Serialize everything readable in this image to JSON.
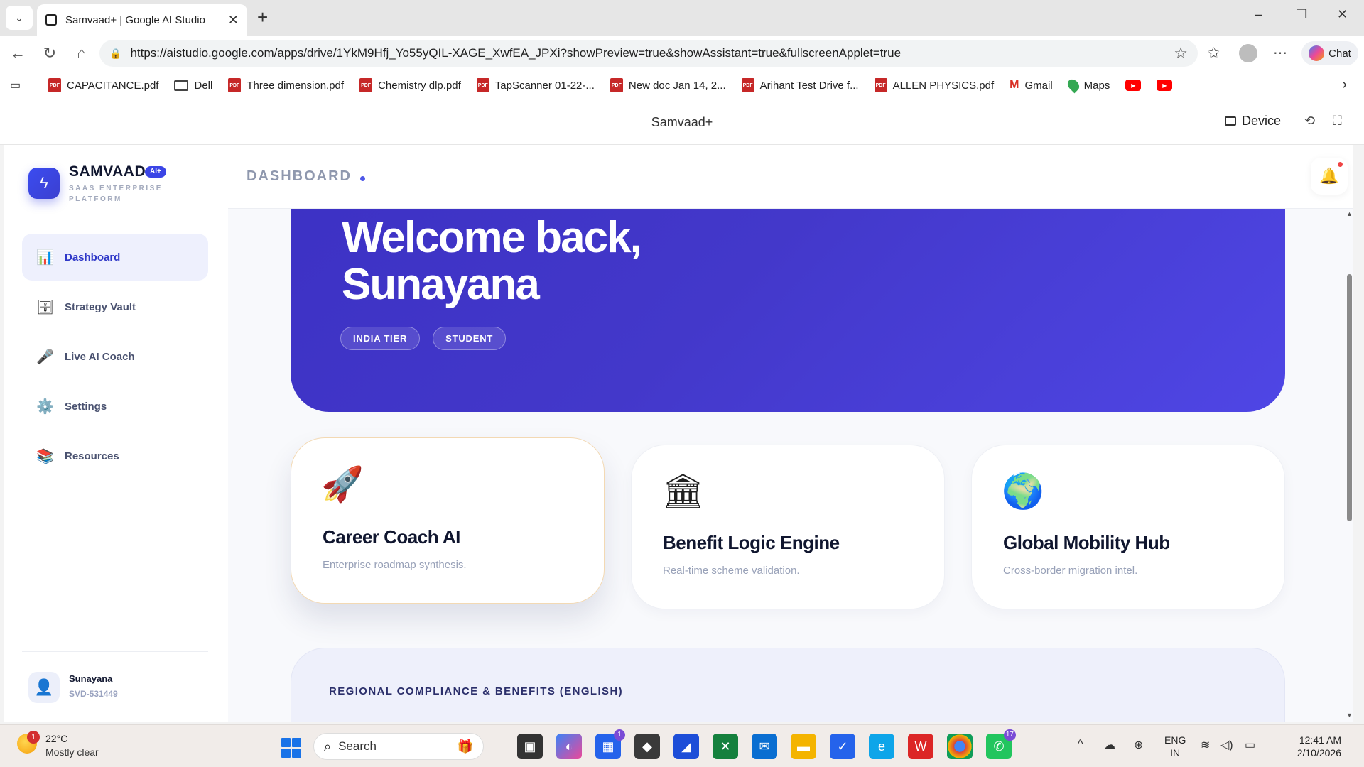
{
  "browser": {
    "tab_title": "Samvaad+ | Google AI Studio",
    "url": "https://aistudio.google.com/apps/drive/1YkM9Hfj_Yo55yQIL-XAGE_XwfEA_JPXi?showPreview=true&showAssistant=true&fullscreenApplet=true",
    "chat_label": "Chat",
    "bookmarks": [
      {
        "label": "CAPACITANCE.pdf",
        "icon": "pdf-icon"
      },
      {
        "label": "Dell",
        "icon": "folder-icon"
      },
      {
        "label": "Three dimension.pdf",
        "icon": "pdf-icon"
      },
      {
        "label": "Chemistry dlp.pdf",
        "icon": "pdf-icon"
      },
      {
        "label": "TapScanner 01-22-...",
        "icon": "pdf-icon"
      },
      {
        "label": "New doc Jan 14, 2...",
        "icon": "pdf-icon"
      },
      {
        "label": "Arihant Test Drive f...",
        "icon": "pdf-icon"
      },
      {
        "label": "ALLEN PHYSICS.pdf",
        "icon": "pdf-icon"
      },
      {
        "label": "Gmail",
        "icon": "gmail-icon"
      },
      {
        "label": "Maps",
        "icon": "maps-icon"
      }
    ]
  },
  "studio": {
    "title": "Samvaad+",
    "device_label": "Device"
  },
  "sidebar": {
    "brand_name": "SAMVAAD",
    "brand_badge": "AI+",
    "brand_sub": "SAAS ENTERPRISE PLATFORM",
    "items": [
      {
        "label": "Dashboard",
        "icon": "bar-chart-icon",
        "active": true
      },
      {
        "label": "Strategy Vault",
        "icon": "vault-icon",
        "active": false
      },
      {
        "label": "Live AI Coach",
        "icon": "microphone-icon",
        "active": false
      },
      {
        "label": "Settings",
        "icon": "gear-icon",
        "active": false
      },
      {
        "label": "Resources",
        "icon": "books-icon",
        "active": false
      }
    ],
    "user": {
      "name": "Sunayana",
      "id": "SVD-531449"
    }
  },
  "topbar": {
    "title": "DASHBOARD"
  },
  "hero": {
    "line1": "Welcome back,",
    "line2": "Sunayana",
    "tags": [
      "INDIA TIER",
      "STUDENT"
    ]
  },
  "cards": [
    {
      "title": "Career Coach AI",
      "subtitle": "Enterprise roadmap synthesis.",
      "icon": "rocket-icon"
    },
    {
      "title": "Benefit Logic Engine",
      "subtitle": "Real-time scheme validation.",
      "icon": "bank-icon"
    },
    {
      "title": "Global Mobility Hub",
      "subtitle": "Cross-border migration intel.",
      "icon": "globe-icon"
    }
  ],
  "compliance": {
    "title": "REGIONAL COMPLIANCE & BENEFITS (ENGLISH)"
  },
  "taskbar": {
    "temp": "22°C",
    "weather": "Mostly clear",
    "weather_badge": "1",
    "search_label": "Search",
    "store_badge": "1",
    "whatsapp_badge": "17",
    "lang_line1": "ENG",
    "lang_line2": "IN",
    "time": "12:41 AM",
    "date": "2/10/2026"
  },
  "colors": {
    "accent": "#3b45e6",
    "hero": "#4338ca",
    "sidebar_active_bg": "#eef0fd"
  }
}
